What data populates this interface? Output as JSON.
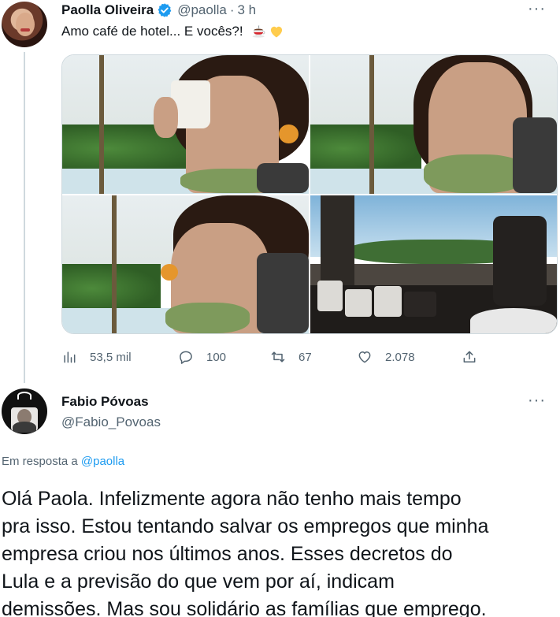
{
  "tweet": {
    "author_name": "Paolla Oliveira",
    "author_handle": "@paolla",
    "separator": "·",
    "time": "3 h",
    "more_label": "···",
    "text": "Amo café de hotel... E vocês?!",
    "emojis": [
      "coffee-cup-icon",
      "yellow-heart-icon"
    ],
    "photos": [
      "photo-1",
      "photo-2",
      "photo-3",
      "photo-4"
    ],
    "stats": {
      "views": "53,5 mil",
      "replies": "100",
      "retweets": "67",
      "likes": "2.078"
    }
  },
  "reply": {
    "author_name": "Fabio Póvoas",
    "author_handle": "@Fabio_Povoas",
    "more_label": "···",
    "reply_to_prefix": "Em resposta a",
    "reply_to_handle": "@paolla",
    "text_lines": [
      "Olá Paola. Infelizmente agora não tenho mais tempo",
      "pra isso. Estou tentando salvar os empregos que minha",
      "empresa criou nos últimos anos. Esses decretos do",
      "Lula e a previsão do que vem por aí, indicam",
      "demissões. Mas sou solidário as famílias que emprego."
    ]
  },
  "colors": {
    "text": "#0f1419",
    "secondary": "#536471",
    "link": "#1d9bf0",
    "verified": "#1d9bf0"
  }
}
